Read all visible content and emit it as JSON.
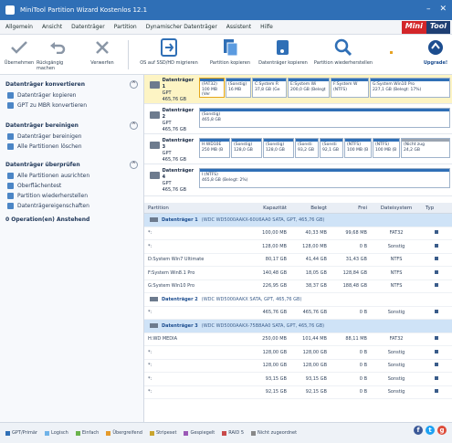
{
  "window": {
    "title": "MiniTool Partition Wizard Kostenlos 12.1",
    "min": "–",
    "close": "✕"
  },
  "menu": [
    "Allgemein",
    "Ansicht",
    "Datenträger",
    "Partition",
    "Dynamischer Datenträger",
    "Assistent",
    "Hilfe"
  ],
  "brand": {
    "part1": "Mini",
    "part2": "Tool"
  },
  "toolbar": {
    "apply": "Übernehmen",
    "undo": "Rückgängig machen",
    "discard": "Verwerfen",
    "os_migrate": "OS auf SSD/HD migrieren",
    "copy_partition": "Partition kopieren",
    "copy_disk": "Datenträger kopieren",
    "partition_recovery": "Partition wiederherstellen",
    "upgrade": "Upgrade!"
  },
  "sidebar": {
    "group1": {
      "title": "Datenträger konvertieren",
      "items": [
        "Datenträger kopieren",
        "GPT zu MBR konvertieren"
      ]
    },
    "group2": {
      "title": "Datenträger bereinigen",
      "items": [
        "Datenträger bereinigen",
        "Alle Partitionen löschen"
      ]
    },
    "group3": {
      "title": "Datenträger überprüfen",
      "items": [
        "Alle Partitionen ausrichten",
        "Oberflächentest",
        "Partition wiederherstellen",
        "Datenträgereigenschaften"
      ]
    },
    "pending": "0 Operation(en) Anstehend"
  },
  "disks": [
    {
      "name": "Datenträger 1",
      "type": "GPT",
      "size": "465,76 GB",
      "parts": [
        {
          "l1": "(FAT32)",
          "l2": "100 MB (Ver"
        },
        {
          "l1": "(Sonstig)",
          "l2": "16 MB"
        },
        {
          "l1": "C:System R",
          "l2": "37,8 GB (Ge"
        },
        {
          "l1": "E:System Wi",
          "l2": "200,0 GB (Belegt"
        },
        {
          "l1": "F:System W",
          "l2": "",
          "extra": "(NTFS)"
        },
        {
          "l1": "G:System Win10 Pro",
          "l2": "227,1 GB (Belegt: 17%)"
        }
      ]
    },
    {
      "name": "Datenträger 2",
      "type": "GPT",
      "size": "465,76 GB",
      "parts": [
        {
          "l1": "(Sonstig)",
          "l2": "465,8 GB"
        }
      ]
    },
    {
      "name": "Datenträger 3",
      "type": "GPT",
      "size": "465,76 GB",
      "parts": [
        {
          "l1": "H:WD10E",
          "l2": "250 MB (B"
        },
        {
          "l1": "(Sonstig)",
          "l2": "128,0 GB"
        },
        {
          "l1": "(Sonstig)",
          "l2": "128,0 GB"
        },
        {
          "l1": "(Sonsti",
          "l2": "93,2 GB"
        },
        {
          "l1": "(Sonsti",
          "l2": "92,1 GB"
        },
        {
          "l1": "(NTFS)",
          "l2": "100 MB (B"
        },
        {
          "l1": "(NTFS)",
          "l2": "100 MB (B"
        },
        {
          "l1": "(Nicht zug",
          "l2": "24,2 GB"
        }
      ]
    },
    {
      "name": "Datenträger 4",
      "type": "GPT",
      "size": "465,76 GB",
      "parts": [
        {
          "l1": "I:(NTFS)",
          "l2": "465,8 GB (Belegt: 2%)"
        }
      ]
    }
  ],
  "table": {
    "headers": [
      "Partition",
      "Kapazität",
      "Belegt",
      "Frei",
      "Dateisystem",
      "Typ"
    ],
    "rows": [
      {
        "kind": "disk",
        "name": "Datenträger 1",
        "desc": "(WDC WD5000AAKX-60U6AA0 SATA, GPT, 465,76 GB)",
        "sel": true
      },
      {
        "kind": "part",
        "c": [
          "*:",
          "100,00 MB",
          "40,33 MB",
          "99,68 MB",
          "FAT32"
        ]
      },
      {
        "kind": "part",
        "c": [
          "*:",
          "128,00 MB",
          "128,00 MB",
          "0 B",
          "Sonstig"
        ]
      },
      {
        "kind": "part",
        "c": [
          "D:System Win7 Ultimate",
          "80,17 GB",
          "41,44 GB",
          "31,43 GB",
          "NTFS"
        ]
      },
      {
        "kind": "part",
        "c": [
          "F:System Win8.1 Pro",
          "140,48 GB",
          "18,05 GB",
          "128,84 GB",
          "NTFS"
        ]
      },
      {
        "kind": "part",
        "c": [
          "G:System Win10 Pro",
          "226,95 GB",
          "38,37 GB",
          "188,48 GB",
          "NTFS"
        ]
      },
      {
        "kind": "disk",
        "name": "Datenträger 2",
        "desc": "(WDC WD5000AAKX SATA, GPT, 465,76 GB)",
        "sel": false
      },
      {
        "kind": "part",
        "c": [
          "*:",
          "465,76 GB",
          "465,76 GB",
          "0 B",
          "Sonstig"
        ]
      },
      {
        "kind": "disk",
        "name": "Datenträger 3",
        "desc": "(WDC WD5000AAKX-75B8AA0 SATA, GPT, 465,76 GB)",
        "sel": true
      },
      {
        "kind": "part",
        "c": [
          "H:WD MEDIA",
          "250,00 MB",
          "101,44 MB",
          "88,11 MB",
          "FAT32"
        ]
      },
      {
        "kind": "part",
        "c": [
          "*:",
          "128,00 GB",
          "128,00 GB",
          "0 B",
          "Sonstig"
        ]
      },
      {
        "kind": "part",
        "c": [
          "*:",
          "128,00 GB",
          "128,00 GB",
          "0 B",
          "Sonstig"
        ]
      },
      {
        "kind": "part",
        "c": [
          "*:",
          "93,15 GB",
          "93,15 GB",
          "0 B",
          "Sonstig"
        ]
      },
      {
        "kind": "part",
        "c": [
          "*:",
          "92,15 GB",
          "92,15 GB",
          "0 B",
          "Sonstig"
        ]
      }
    ]
  },
  "legend": [
    {
      "label": "GPT/Primär",
      "color": "#2f6fb6"
    },
    {
      "label": "Logisch",
      "color": "#6fb3e8"
    },
    {
      "label": "Einfach",
      "color": "#6ab34c"
    },
    {
      "label": "Übergreifend",
      "color": "#e59a2a"
    },
    {
      "label": "Stripeset",
      "color": "#c9a52e"
    },
    {
      "label": "Gespiegelt",
      "color": "#9b59b6"
    },
    {
      "label": "RAID 5",
      "color": "#c84a4a"
    },
    {
      "label": "Nicht zugeordnet",
      "color": "#888888"
    }
  ],
  "social": [
    {
      "glyph": "f",
      "color": "#3b5998"
    },
    {
      "glyph": "t",
      "color": "#1da1f2"
    },
    {
      "glyph": "g",
      "color": "#dd4b39"
    }
  ]
}
